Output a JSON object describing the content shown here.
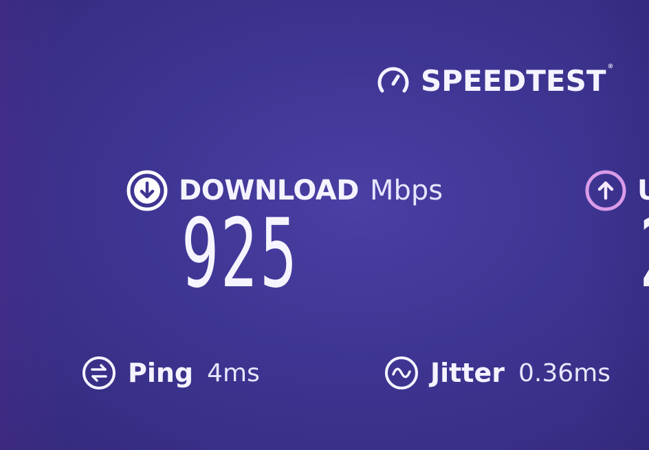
{
  "brand": {
    "name": "SPEEDTEST",
    "trademark": "®"
  },
  "download": {
    "label": "DOWNLOAD",
    "unit": "Mbps",
    "value": "925",
    "icon": "download-arrow-icon",
    "icon_color": "#ffffff"
  },
  "upload": {
    "label_partial": "U",
    "value_partial": "2",
    "icon": "upload-arrow-icon",
    "icon_color": "#d99be8"
  },
  "ping": {
    "label": "Ping",
    "value": "4ms",
    "icon": "ping-arrows-icon"
  },
  "jitter": {
    "label": "Jitter",
    "value": "0.36ms",
    "icon": "jitter-wave-icon"
  },
  "colors": {
    "background": "#3e3592",
    "text": "#f4f3ff",
    "upload_accent": "#d99be8"
  }
}
